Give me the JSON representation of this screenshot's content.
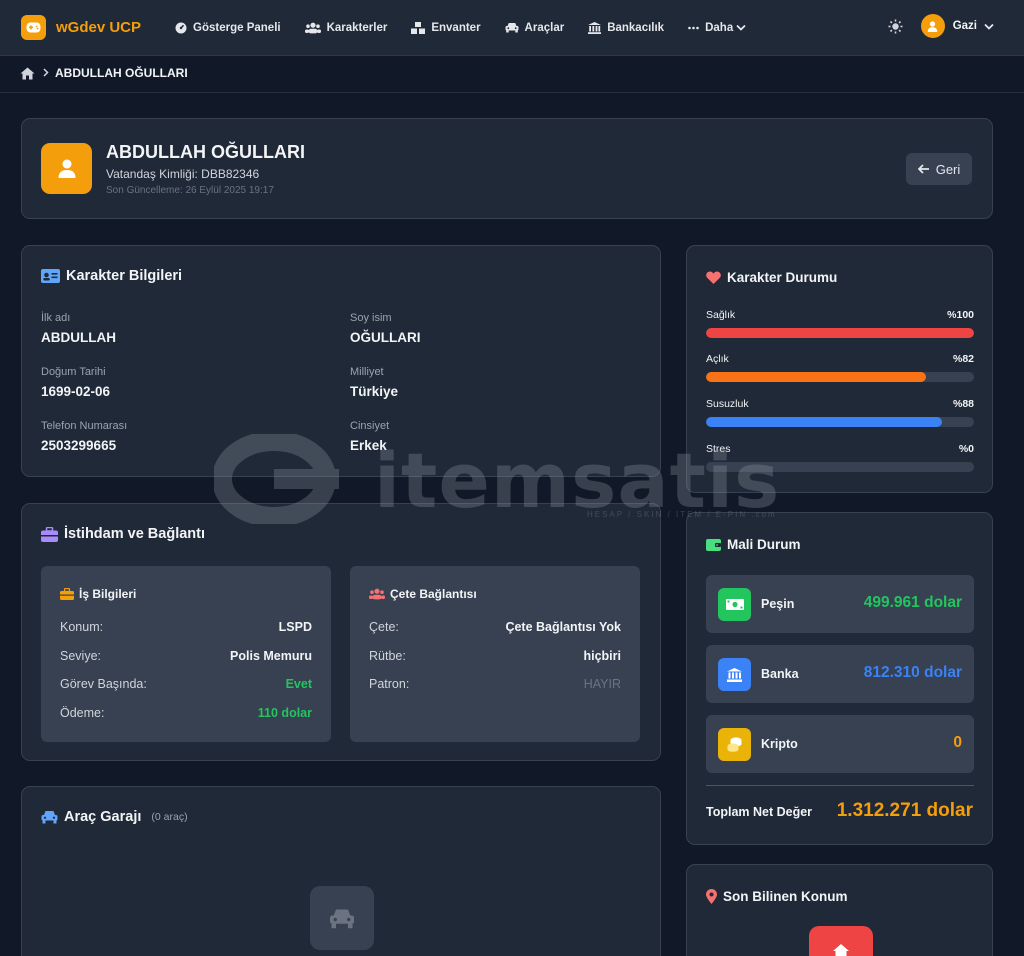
{
  "nav": {
    "brand": "wGdev UCP",
    "items": [
      {
        "label": "Gösterge Paneli",
        "icon": "dashboard-gauge-icon"
      },
      {
        "label": "Karakterler",
        "icon": "users-icon"
      },
      {
        "label": "Envanter",
        "icon": "boxes-icon"
      },
      {
        "label": "Araçlar",
        "icon": "car-icon"
      },
      {
        "label": "Bankacılık",
        "icon": "bank-icon"
      },
      {
        "label": "Daha",
        "icon": "more-dots-icon"
      }
    ],
    "user": "Gazi"
  },
  "breadcrumb": {
    "current": "ABDULLAH OĞULLARI"
  },
  "profile": {
    "name": "ABDULLAH OĞULLARI",
    "citizen_id": "Vatandaş Kimliği: DBB82346",
    "last_update": "Son Güncelleme: 26 Eylül 2025 19:17",
    "back_label": "Geri"
  },
  "character_info": {
    "title": "Karakter Bilgileri",
    "fields": [
      {
        "label": "İlk adı",
        "value": "ABDULLAH"
      },
      {
        "label": "Soy isim",
        "value": "OĞULLARI"
      },
      {
        "label": "Doğum Tarihi",
        "value": "1699-02-06"
      },
      {
        "label": "Milliyet",
        "value": "Türkiye"
      },
      {
        "label": "Telefon Numarası",
        "value": "2503299665"
      },
      {
        "label": "Cinsiyet",
        "value": "Erkek"
      }
    ]
  },
  "status": {
    "title": "Karakter Durumu",
    "stats": [
      {
        "label": "Sağlık",
        "pct_text": "%100",
        "value": 100,
        "color": "#ef4444"
      },
      {
        "label": "Açlık",
        "pct_text": "%82",
        "value": 82,
        "color": "#f97316"
      },
      {
        "label": "Susuzluk",
        "pct_text": "%88",
        "value": 88,
        "color": "#3b82f6"
      },
      {
        "label": "Stres",
        "pct_text": "%0",
        "value": 0,
        "color": "#a855f7"
      }
    ]
  },
  "employment": {
    "title": "İstihdam ve Bağlantı",
    "job": {
      "title": "İş Bilgileri",
      "rows": [
        {
          "k": "Konum:",
          "v": "LSPD"
        },
        {
          "k": "Seviye:",
          "v": "Polis Memuru"
        },
        {
          "k": "Görev Başında:",
          "v": "Evet"
        },
        {
          "k": "Ödeme:",
          "v": "110 dolar"
        }
      ]
    },
    "gang": {
      "title": "Çete Bağlantısı",
      "rows": [
        {
          "k": "Çete:",
          "v": "Çete Bağlantısı Yok"
        },
        {
          "k": "Rütbe:",
          "v": "hiçbiri"
        },
        {
          "k": "Patron:",
          "v": "HAYIR"
        }
      ]
    }
  },
  "finance": {
    "title": "Mali Durum",
    "rows": [
      {
        "label": "Peşin",
        "value": "499.961 dolar",
        "color": "#22c55e"
      },
      {
        "label": "Banka",
        "value": "812.310 dolar",
        "color": "#3b82f6"
      },
      {
        "label": "Kripto",
        "value": "0",
        "color": "#f59e0b"
      }
    ],
    "net_label": "Toplam Net Değer",
    "net_value": "1.312.271 dolar"
  },
  "garage": {
    "title": "Araç Garajı",
    "count": "(0 araç)"
  },
  "location": {
    "title": "Son Bilinen Konum"
  },
  "watermark": {
    "text": "itemsatis",
    "sub": "HESAP / SKIN / ITEM / E-PIN .com"
  },
  "colors": {
    "accent": "#f59e0b",
    "bg": "#111827",
    "card": "#1f2937",
    "inner": "#374151"
  }
}
